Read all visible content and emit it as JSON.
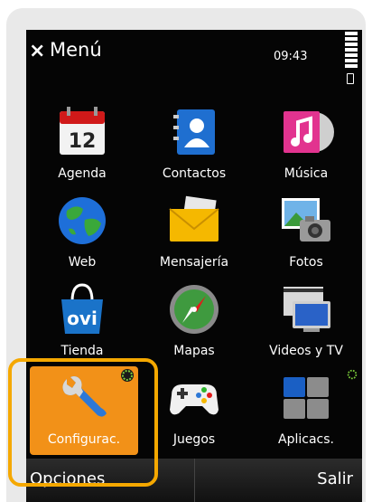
{
  "status": {
    "close_glyph": "×",
    "title": "Menú",
    "time": "09:43"
  },
  "apps": [
    {
      "label": "Agenda",
      "icon": "calendar-icon",
      "day": "12"
    },
    {
      "label": "Contactos",
      "icon": "contacts-icon"
    },
    {
      "label": "Música",
      "icon": "music-icon"
    },
    {
      "label": "Web",
      "icon": "globe-icon"
    },
    {
      "label": "Mensajería",
      "icon": "envelope-icon"
    },
    {
      "label": "Fotos",
      "icon": "photos-icon"
    },
    {
      "label": "Tienda",
      "icon": "ovi-store-icon",
      "brand": "ovi"
    },
    {
      "label": "Mapas",
      "icon": "compass-icon"
    },
    {
      "label": "Videos y TV",
      "icon": "video-icon"
    },
    {
      "label": "Configurac.",
      "icon": "wrench-icon",
      "selected": true
    },
    {
      "label": "Juegos",
      "icon": "gamepad-icon"
    },
    {
      "label": "Aplicacs.",
      "icon": "apps-icon"
    }
  ],
  "softkeys": {
    "left": "Opciones",
    "right": "Salir"
  },
  "colors": {
    "selected": "#f29118",
    "highlight": "#f5a800",
    "screen": "#050505"
  }
}
